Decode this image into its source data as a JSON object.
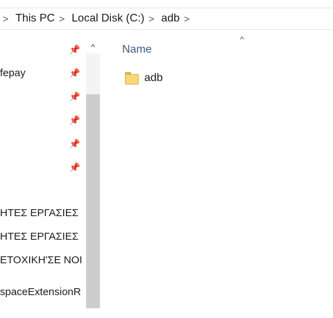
{
  "breadcrumb": {
    "separator": ">",
    "items": [
      "This PC",
      "Local Disk (C:)",
      "adb"
    ]
  },
  "navigation_pane": {
    "items": [
      {
        "label": "",
        "pinned": true
      },
      {
        "label": "fepay",
        "pinned": true
      },
      {
        "label": "",
        "pinned": true
      },
      {
        "label": "",
        "pinned": true
      },
      {
        "label": "",
        "pinned": true
      },
      {
        "label": "",
        "pinned": true
      },
      {
        "label": "ΗΤΕΣ ΕΡΓΑΣΙΕΣ",
        "pinned": false
      },
      {
        "label": "ΗΤΕΣ ΕΡΓΑΣΙΕΣ",
        "pinned": false
      },
      {
        "label": "ΕΤΟΧΙΚΗ'ΣΕ ΝΟΙ",
        "pinned": false
      },
      {
        "label": "spaceExtensionR",
        "pinned": false
      }
    ],
    "scroll_up_glyph": "^"
  },
  "file_list": {
    "column_header": "Name",
    "sort_glyph": "^",
    "items": [
      {
        "name": "adb",
        "icon": "folder-icon"
      }
    ]
  },
  "icons": {
    "pin": "pin-icon",
    "folder": "folder-icon"
  },
  "colors": {
    "folder_fill": "#f8d775",
    "header_text": "#3b5a7a",
    "scroll_thumb": "#cdcdcd"
  }
}
